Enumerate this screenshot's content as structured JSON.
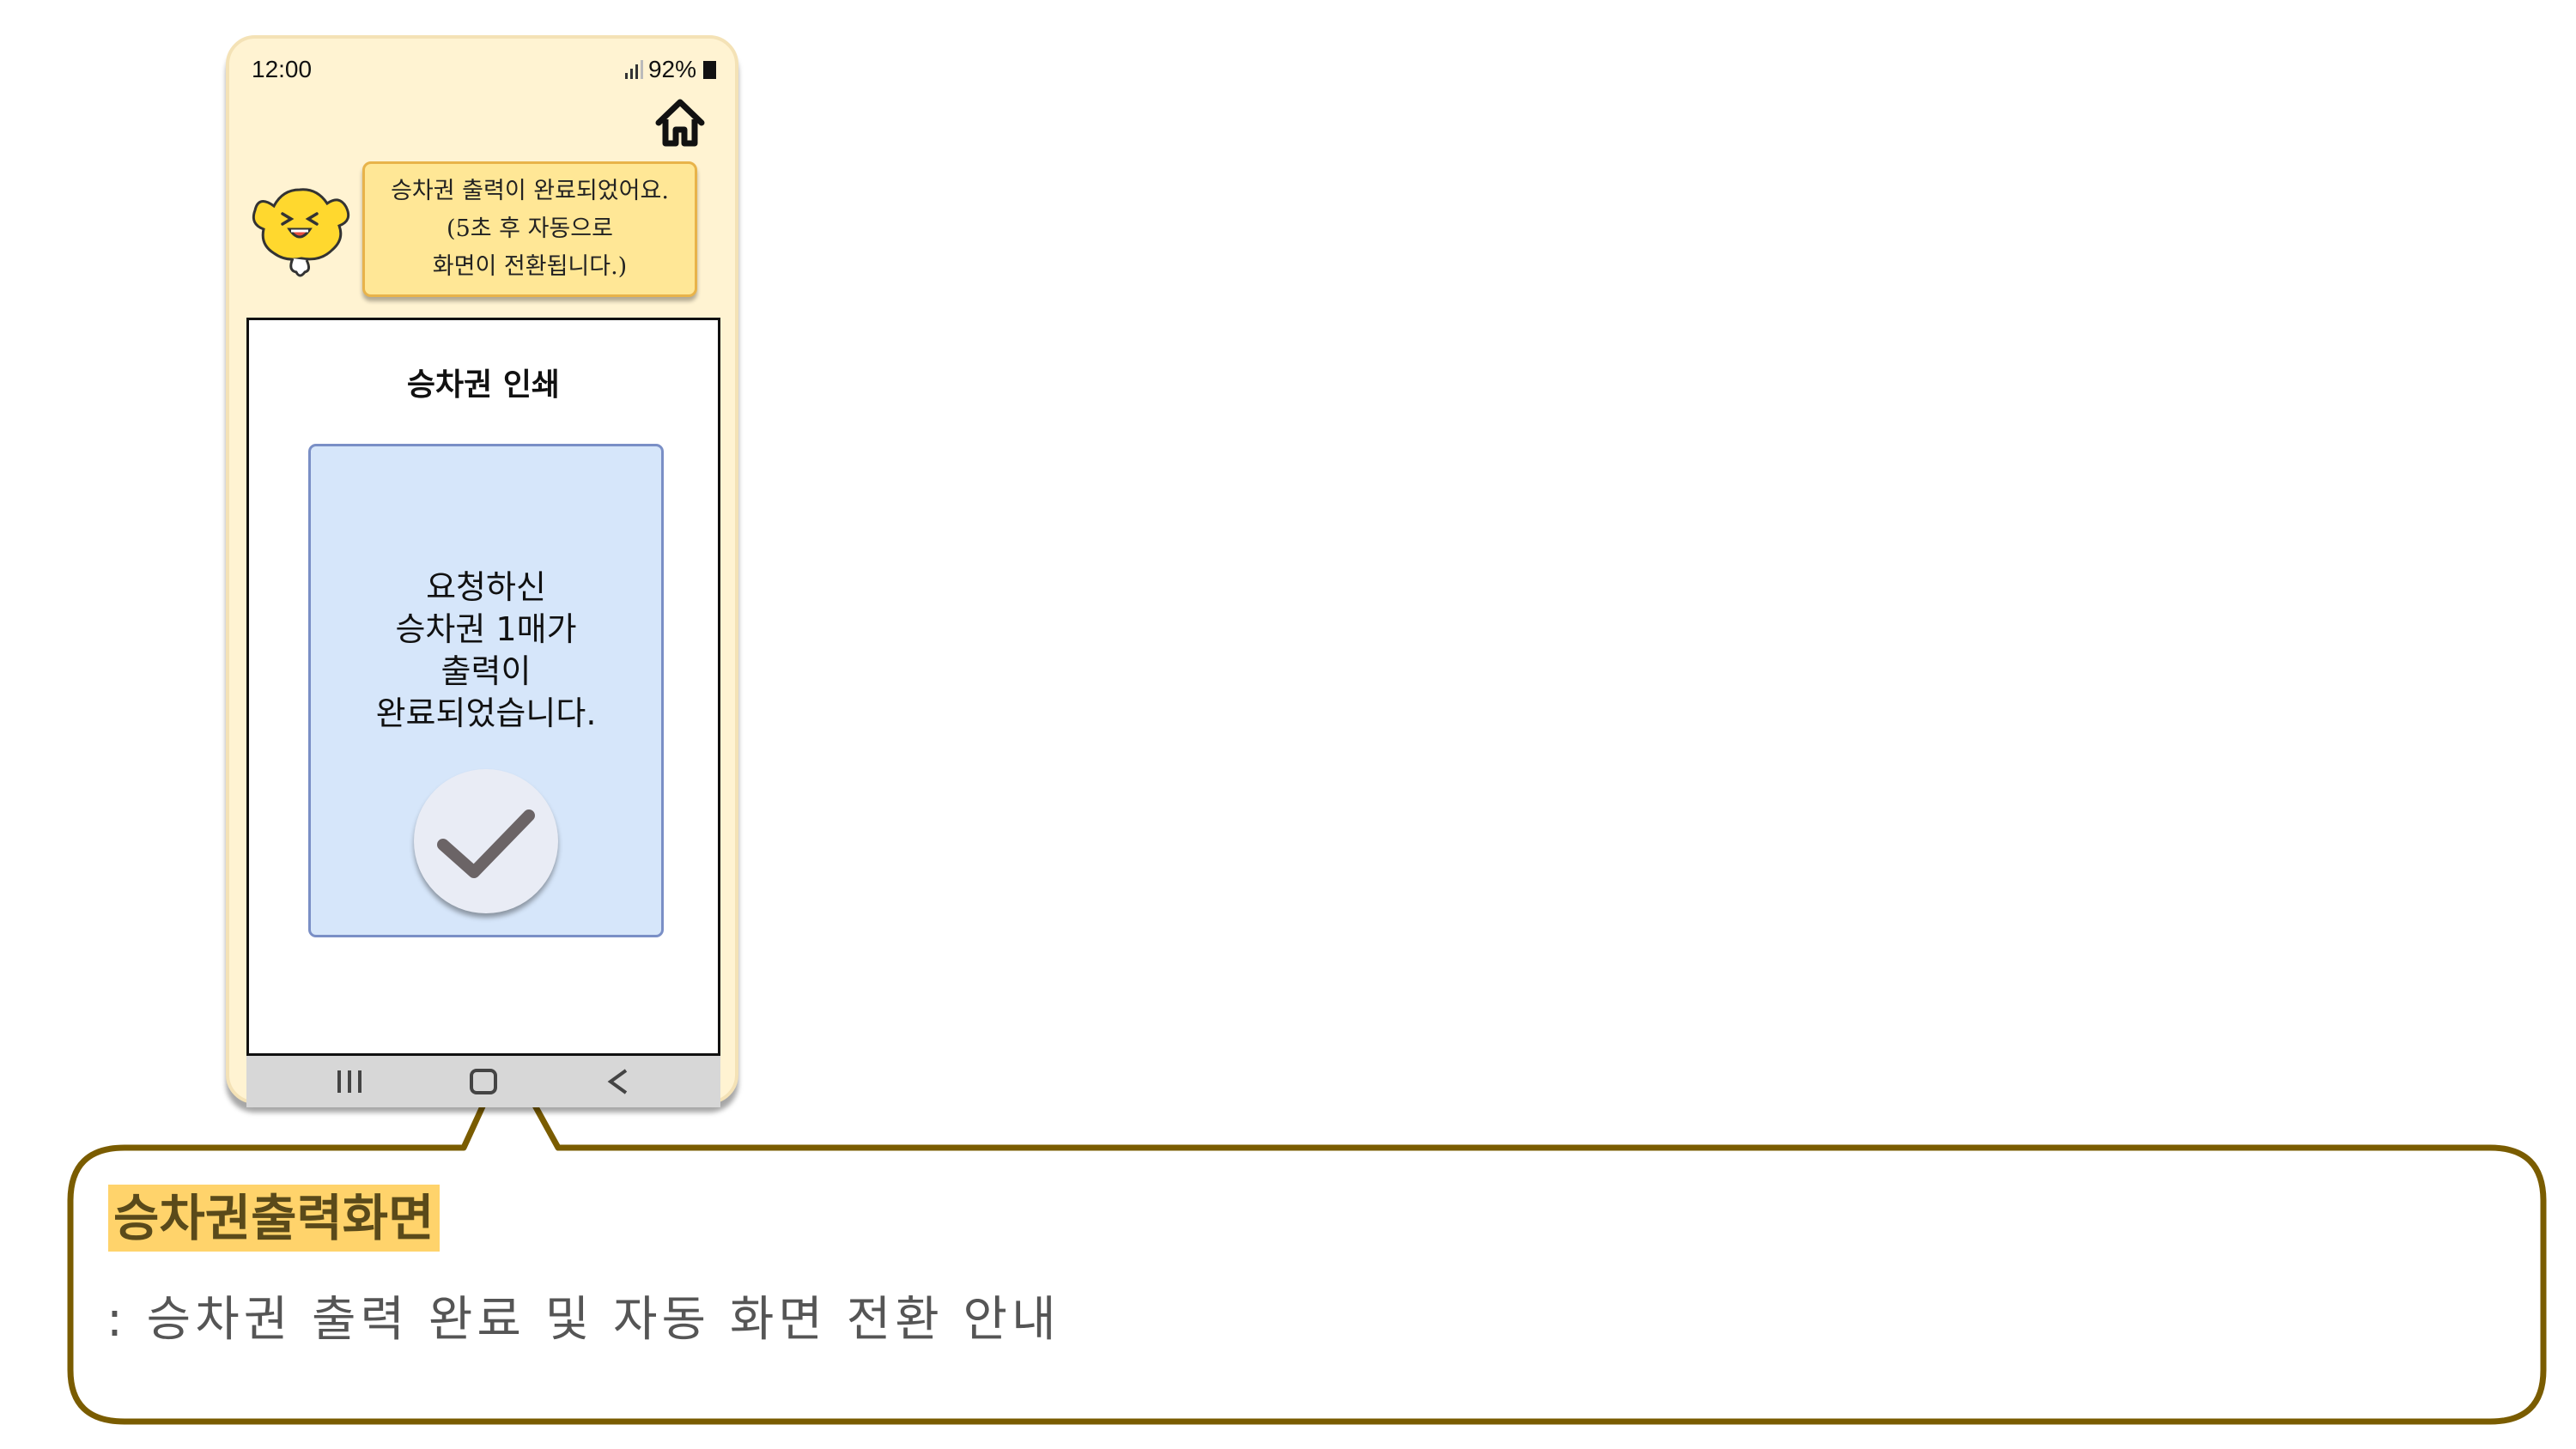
{
  "status_bar": {
    "time": "12:00",
    "battery": "92%"
  },
  "speech_bubble": {
    "lines": [
      "승차권 출력이 완료되었어요.",
      "(5초 후 자동으로",
      "화면이 전환됩니다.)"
    ]
  },
  "screen": {
    "title": "승차권 인쇄",
    "message_lines": [
      "요청하신",
      "승차권 1매가",
      "출력이",
      "완료되었습니다."
    ]
  },
  "nav": {
    "recent_icon": "recent-apps-icon",
    "home_icon": "home-circle-icon",
    "back_icon": "back-icon"
  },
  "callout": {
    "title": "승차권출력화면",
    "description": ": 승차권 출력 완료 및 자동 화면 전환 안내"
  },
  "colors": {
    "phone_bg": "#fff3d2",
    "bubble_bg": "#ffe796",
    "card_bg": "#d6e6fa",
    "callout_border": "#7a5c00",
    "title_highlight": "#ffd36b"
  }
}
